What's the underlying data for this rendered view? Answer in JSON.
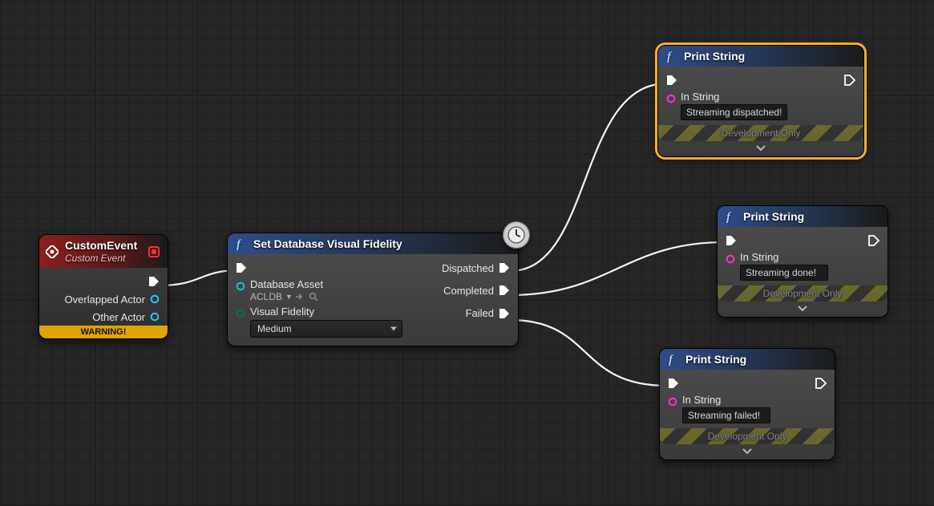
{
  "nodes": {
    "customEvent": {
      "title": "CustomEvent",
      "subtitle": "Custom Event",
      "outputs": {
        "overlapped": "Overlapped Actor",
        "other": "Other Actor"
      },
      "warning": "WARNING!"
    },
    "setFidelity": {
      "title": "Set Database Visual Fidelity",
      "inputs": {
        "dbAssetLabel": "Database Asset",
        "dbAssetValue": "ACLDB",
        "visualFidelityLabel": "Visual Fidelity",
        "visualFidelityValue": "Medium"
      },
      "outputs": {
        "dispatched": "Dispatched",
        "completed": "Completed",
        "failed": "Failed"
      }
    },
    "print1": {
      "title": "Print String",
      "inStringLabel": "In String",
      "inStringValue": "Streaming dispatched!",
      "devOnly": "Development Only"
    },
    "print2": {
      "title": "Print String",
      "inStringLabel": "In String",
      "inStringValue": "Streaming done!",
      "devOnly": "Development Only"
    },
    "print3": {
      "title": "Print String",
      "inStringLabel": "In String",
      "inStringValue": "Streaming failed!",
      "devOnly": "Development Only"
    }
  }
}
